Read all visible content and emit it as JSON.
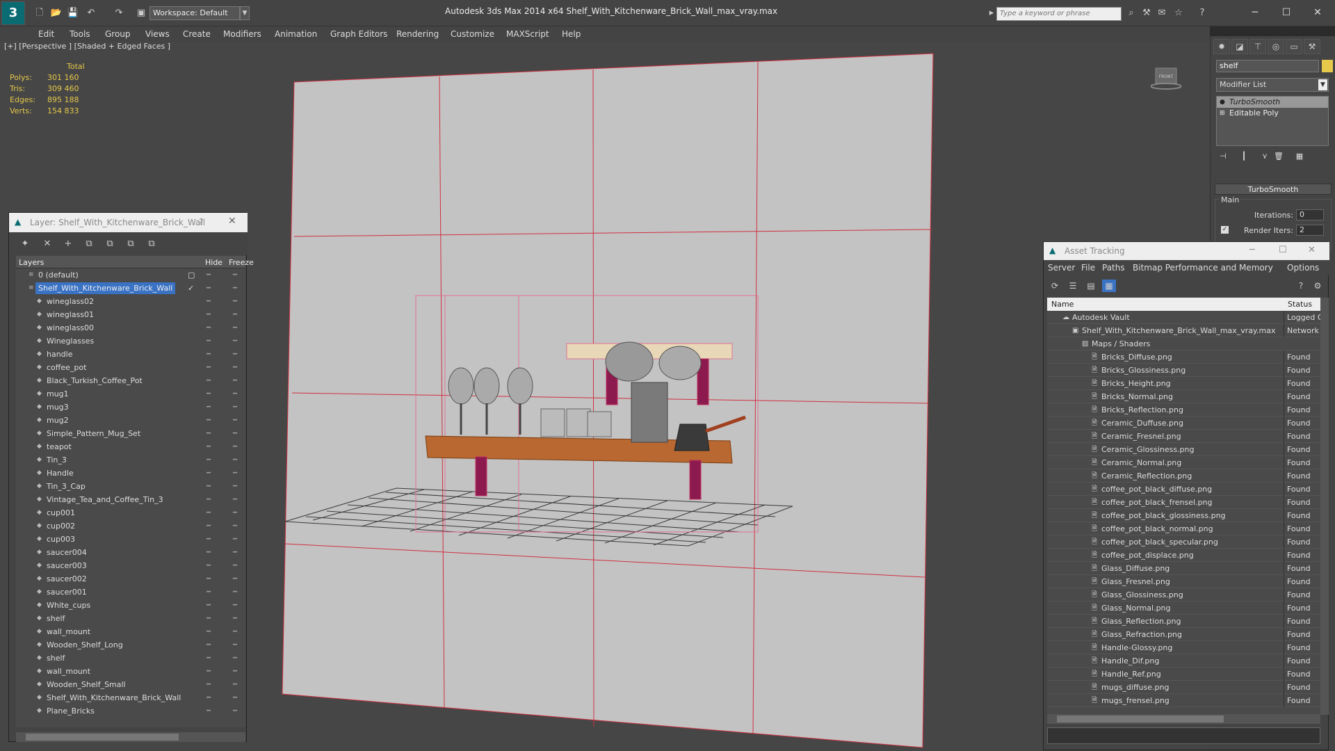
{
  "app": {
    "title": "Autodesk 3ds Max  2014 x64      Shelf_With_Kitchenware_Brick_Wall_max_vray.max",
    "workspace": "Workspace: Default",
    "search_placeholder": "Type a keyword or phrase",
    "logo": "3"
  },
  "menu": [
    "Edit",
    "Tools",
    "Group",
    "Views",
    "Create",
    "Modifiers",
    "Animation",
    "Graph Editors",
    "Rendering",
    "Customize",
    "MAXScript",
    "Help"
  ],
  "viewport": {
    "label": "[+] [Perspective ] [Shaded + Edged Faces ]",
    "stats": {
      "header": "Total",
      "rows": [
        {
          "k": "Polys:",
          "v": "301 160"
        },
        {
          "k": "Tris:",
          "v": "309 460"
        },
        {
          "k": "Edges:",
          "v": "895 188"
        },
        {
          "k": "Verts:",
          "v": "154 833"
        }
      ]
    },
    "viewcube_label": "FRONT"
  },
  "command_panel": {
    "object_name": "shelf",
    "modifier_list": "Modifier List",
    "stack": [
      "TurboSmooth",
      "Editable Poly"
    ],
    "rollout_title": "TurboSmooth",
    "group_main": "Main",
    "iterations_label": "Iterations:",
    "iterations": "0",
    "render_iters_label": "Render Iters:",
    "render_iters": "2",
    "object_color": "#e6c84a"
  },
  "layer_dialog": {
    "title": "Layer: Shelf_With_Kitchenware_Brick_Wall",
    "help": "?",
    "close": "✕",
    "col_layers": "Layers",
    "col_hide": "Hide",
    "col_freeze": "Freeze",
    "rows": [
      {
        "name": "0 (default)",
        "level": 0
      },
      {
        "name": "Shelf_With_Kitchenware_Brick_Wall",
        "level": 0,
        "selected": true
      },
      {
        "name": "wineglass02",
        "level": 1
      },
      {
        "name": "wineglass01",
        "level": 1
      },
      {
        "name": "wineglass00",
        "level": 1
      },
      {
        "name": "Wineglasses",
        "level": 1
      },
      {
        "name": "handle",
        "level": 1
      },
      {
        "name": "coffee_pot",
        "level": 1
      },
      {
        "name": "Black_Turkish_Coffee_Pot",
        "level": 1
      },
      {
        "name": "mug1",
        "level": 1
      },
      {
        "name": "mug3",
        "level": 1
      },
      {
        "name": "mug2",
        "level": 1
      },
      {
        "name": "Simple_Pattern_Mug_Set",
        "level": 1
      },
      {
        "name": "teapot",
        "level": 1
      },
      {
        "name": "Tin_3",
        "level": 1
      },
      {
        "name": "Handle",
        "level": 1
      },
      {
        "name": "Tin_3_Cap",
        "level": 1
      },
      {
        "name": "Vintage_Tea_and_Coffee_Tin_3",
        "level": 1
      },
      {
        "name": "cup001",
        "level": 1
      },
      {
        "name": "cup002",
        "level": 1
      },
      {
        "name": "cup003",
        "level": 1
      },
      {
        "name": "saucer004",
        "level": 1
      },
      {
        "name": "saucer003",
        "level": 1
      },
      {
        "name": "saucer002",
        "level": 1
      },
      {
        "name": "saucer001",
        "level": 1
      },
      {
        "name": "White_cups",
        "level": 1
      },
      {
        "name": "shelf",
        "level": 1
      },
      {
        "name": "wall_mount",
        "level": 1
      },
      {
        "name": "Wooden_Shelf_Long",
        "level": 1
      },
      {
        "name": "shelf",
        "level": 1
      },
      {
        "name": "wall_mount",
        "level": 1
      },
      {
        "name": "Wooden_Shelf_Small",
        "level": 1
      },
      {
        "name": "Shelf_With_Kitchenware_Brick_Wall",
        "level": 1
      },
      {
        "name": "Plane_Bricks",
        "level": 1
      }
    ]
  },
  "asset_dialog": {
    "title": "Asset Tracking",
    "menu": [
      "Server",
      "File",
      "Paths",
      "Bitmap Performance and Memory",
      "Options"
    ],
    "col_name": "Name",
    "col_status": "Status",
    "rows": [
      {
        "name": "Autodesk Vault",
        "status": "Logged O",
        "level": 0
      },
      {
        "name": "Shelf_With_Kitchenware_Brick_Wall_max_vray.max",
        "status": "Network",
        "level": 1
      },
      {
        "name": "Maps / Shaders",
        "status": "",
        "level": 2
      },
      {
        "name": "Bricks_Diffuse.png",
        "status": "Found",
        "level": 3
      },
      {
        "name": "Bricks_Glossiness.png",
        "status": "Found",
        "level": 3
      },
      {
        "name": "Bricks_Height.png",
        "status": "Found",
        "level": 3
      },
      {
        "name": "Bricks_Normal.png",
        "status": "Found",
        "level": 3
      },
      {
        "name": "Bricks_Reflection.png",
        "status": "Found",
        "level": 3
      },
      {
        "name": "Ceramic_Duffuse.png",
        "status": "Found",
        "level": 3
      },
      {
        "name": "Ceramic_Fresnel.png",
        "status": "Found",
        "level": 3
      },
      {
        "name": "Ceramic_Glossiness.png",
        "status": "Found",
        "level": 3
      },
      {
        "name": "Ceramic_Normal.png",
        "status": "Found",
        "level": 3
      },
      {
        "name": "Ceramic_Reflection.png",
        "status": "Found",
        "level": 3
      },
      {
        "name": "coffee_pot_black_diffuse.png",
        "status": "Found",
        "level": 3
      },
      {
        "name": "coffee_pot_black_frensel.png",
        "status": "Found",
        "level": 3
      },
      {
        "name": "coffee_pot_black_glossiness.png",
        "status": "Found",
        "level": 3
      },
      {
        "name": "coffee_pot_black_normal.png",
        "status": "Found",
        "level": 3
      },
      {
        "name": "coffee_pot_black_specular.png",
        "status": "Found",
        "level": 3
      },
      {
        "name": "coffee_pot_displace.png",
        "status": "Found",
        "level": 3
      },
      {
        "name": "Glass_Diffuse.png",
        "status": "Found",
        "level": 3
      },
      {
        "name": "Glass_Fresnel.png",
        "status": "Found",
        "level": 3
      },
      {
        "name": "Glass_Glossiness.png",
        "status": "Found",
        "level": 3
      },
      {
        "name": "Glass_Normal.png",
        "status": "Found",
        "level": 3
      },
      {
        "name": "Glass_Reflection.png",
        "status": "Found",
        "level": 3
      },
      {
        "name": "Glass_Refraction.png",
        "status": "Found",
        "level": 3
      },
      {
        "name": "Handle-Glossy.png",
        "status": "Found",
        "level": 3
      },
      {
        "name": "Handle_Dif.png",
        "status": "Found",
        "level": 3
      },
      {
        "name": "Handle_Ref.png",
        "status": "Found",
        "level": 3
      },
      {
        "name": "mugs_diffuse.png",
        "status": "Found",
        "level": 3
      },
      {
        "name": "mugs_frensel.png",
        "status": "Found",
        "level": 3
      }
    ]
  }
}
